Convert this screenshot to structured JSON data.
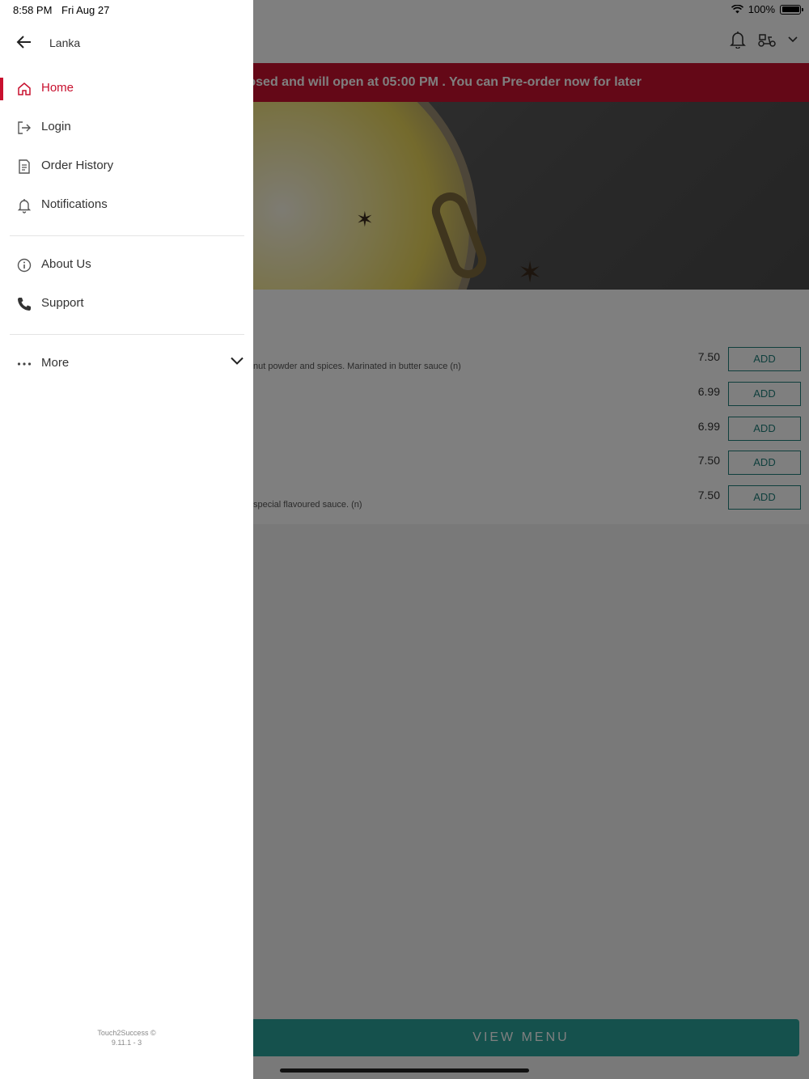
{
  "status_bar": {
    "time": "8:58 PM",
    "date": "Fri Aug 27",
    "battery": "100%"
  },
  "drawer": {
    "store_name": "Lanka",
    "items": [
      {
        "label": "Home",
        "icon": "home-icon",
        "active": true
      },
      {
        "label": "Login",
        "icon": "login-icon"
      },
      {
        "label": "Order History",
        "icon": "receipt-icon"
      },
      {
        "label": "Notifications",
        "icon": "bell-icon"
      },
      {
        "label": "About Us",
        "icon": "info-icon"
      },
      {
        "label": "Support",
        "icon": "phone-icon"
      },
      {
        "label": "More",
        "icon": "more-dots-icon"
      }
    ],
    "footer": {
      "line1": "Touch2Success ©",
      "line2": "9.11.1 - 3"
    }
  },
  "app": {
    "banner_text": "osed and will open at 05:00 PM . You can Pre-order now for later",
    "menu_items": [
      {
        "desc": "nut powder and spices. Marinated in butter sauce (n)",
        "price": "7.50",
        "action": "ADD"
      },
      {
        "desc": "",
        "price": "6.99",
        "action": "ADD"
      },
      {
        "desc": "",
        "price": "6.99",
        "action": "ADD"
      },
      {
        "desc": "",
        "price": "7.50",
        "action": "ADD"
      },
      {
        "desc": "special flavoured sauce. (n)",
        "price": "7.50",
        "action": "ADD"
      }
    ],
    "view_menu_label": "VIEW MENU"
  },
  "colors": {
    "accent": "#c8102e",
    "teal": "#2aa39b",
    "overlay": "rgba(0,0,0,0.5)"
  }
}
